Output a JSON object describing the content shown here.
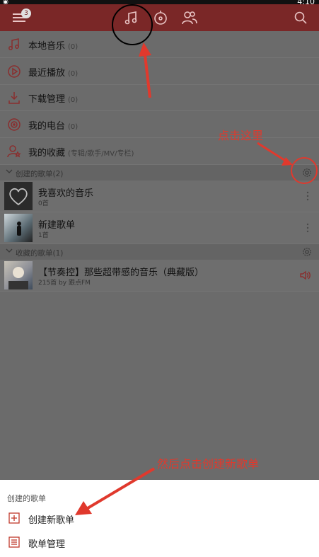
{
  "status": {
    "time": "4:10"
  },
  "topbar": {
    "badge": "3"
  },
  "menu": [
    {
      "label": "本地音乐",
      "count": "(0)"
    },
    {
      "label": "最近播放",
      "count": "(0)"
    },
    {
      "label": "下载管理",
      "count": "(0)"
    },
    {
      "label": "我的电台",
      "count": "(0)"
    },
    {
      "label": "我的收藏",
      "count": "(专辑/歌手/MV/专栏)"
    }
  ],
  "created_section": {
    "label": "创建的歌单(2)"
  },
  "created_playlists": [
    {
      "title": "我喜欢的音乐",
      "sub": "0首"
    },
    {
      "title": "新建歌单",
      "sub": "1首"
    }
  ],
  "collected_section": {
    "label": "收藏的歌单(1)"
  },
  "collected_playlists": [
    {
      "title": "【节奏控】那些超带感的音乐（典藏版）",
      "sub": "215首 by 跟点FM"
    }
  ],
  "sheet": {
    "title": "创建的歌单",
    "create_label": "创建新歌单",
    "manage_label": "歌单管理"
  },
  "annotations": {
    "click_here": "点击这里",
    "then_create": "然后点击创建新歌单"
  },
  "colors": {
    "accent": "#e0392d",
    "topbar": "#7a2727"
  }
}
